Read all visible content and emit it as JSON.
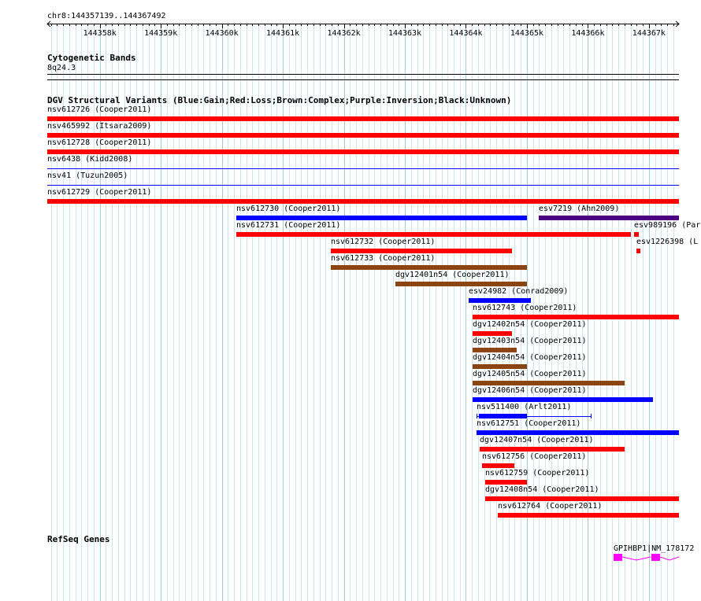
{
  "ruler": {
    "range_label": "chr8:144357139..144367492",
    "start": 144357139,
    "end": 144367492,
    "ticks": [
      {
        "pos": 144358000,
        "label": "144358k"
      },
      {
        "pos": 144359000,
        "label": "144359k"
      },
      {
        "pos": 144360000,
        "label": "144360k"
      },
      {
        "pos": 144361000,
        "label": "144361k"
      },
      {
        "pos": 144362000,
        "label": "144362k"
      },
      {
        "pos": 144363000,
        "label": "144363k"
      },
      {
        "pos": 144364000,
        "label": "144364k"
      },
      {
        "pos": 144365000,
        "label": "144365k"
      },
      {
        "pos": 144366000,
        "label": "144366k"
      },
      {
        "pos": 144367000,
        "label": "144367k"
      }
    ]
  },
  "cytobands": {
    "title": "Cytogenetic Bands",
    "band": "8q24.3"
  },
  "dgv": {
    "title": "DGV Structural Variants (Blue:Gain;Red:Loss;Brown:Complex;Purple:Inversion;Black:Unknown)",
    "colors": {
      "gain": "#0000ff",
      "loss": "#ff0000",
      "complex": "#8b4513",
      "inversion": "#4b0082",
      "unknown": "#000000"
    },
    "features": [
      {
        "label": "nsv612726 (Cooper2011)",
        "type": "loss",
        "start": 144357139,
        "end": 144367492,
        "row": 0,
        "style": "bar"
      },
      {
        "label": "nsv465992 (Itsara2009)",
        "type": "loss",
        "start": 144357139,
        "end": 144367492,
        "row": 1,
        "style": "bar"
      },
      {
        "label": "nsv612728 (Cooper2011)",
        "type": "loss",
        "start": 144357139,
        "end": 144367492,
        "row": 2,
        "style": "bar"
      },
      {
        "label": "nsv6438 (Kidd2008)",
        "type": "gain",
        "start": 144357139,
        "end": 144367492,
        "row": 3,
        "style": "thin"
      },
      {
        "label": "nsv41 (Tuzun2005)",
        "type": "gain",
        "start": 144357139,
        "end": 144367492,
        "row": 4,
        "style": "thin"
      },
      {
        "label": "nsv612729 (Cooper2011)",
        "type": "loss",
        "start": 144357139,
        "end": 144367492,
        "row": 5,
        "style": "bar"
      },
      {
        "label": "nsv612730 (Cooper2011)",
        "type": "gain",
        "start": 144360240,
        "end": 144365000,
        "row": 6,
        "style": "bar"
      },
      {
        "label": "esv7219 (Ahn2009)",
        "type": "inversion",
        "start": 144365200,
        "end": 144367492,
        "row": 6,
        "style": "bar"
      },
      {
        "label": "nsv612731 (Cooper2011)",
        "type": "loss",
        "start": 144360240,
        "end": 144366700,
        "row": 7,
        "style": "bar"
      },
      {
        "label": "esv989196 (Par",
        "type": "loss",
        "start": 144366760,
        "end": 144366840,
        "row": 7,
        "style": "bar"
      },
      {
        "label": "esv1226398 (L",
        "type": "loss",
        "start": 144366790,
        "end": 144366860,
        "row": 8,
        "style": "bar"
      },
      {
        "label": "nsv612732 (Cooper2011)",
        "type": "loss",
        "start": 144361780,
        "end": 144364760,
        "row": 8,
        "style": "bar"
      },
      {
        "label": "nsv612733 (Cooper2011)",
        "type": "complex",
        "start": 144361780,
        "end": 144365000,
        "row": 9,
        "style": "bar"
      },
      {
        "label": "dgv12401n54 (Cooper2011)",
        "type": "complex",
        "start": 144362840,
        "end": 144365000,
        "row": 10,
        "style": "bar"
      },
      {
        "label": "esv24982 (Conrad2009)",
        "type": "gain",
        "start": 144364050,
        "end": 144365060,
        "row": 11,
        "style": "bar"
      },
      {
        "label": "nsv612743 (Cooper2011)",
        "type": "loss",
        "start": 144364110,
        "end": 144367492,
        "row": 12,
        "style": "bar"
      },
      {
        "label": "dgv12402n54 (Cooper2011)",
        "type": "loss",
        "start": 144364110,
        "end": 144364750,
        "row": 13,
        "style": "bar"
      },
      {
        "label": "dgv12403n54 (Cooper2011)",
        "type": "complex",
        "start": 144364110,
        "end": 144364830,
        "row": 14,
        "style": "bar"
      },
      {
        "label": "dgv12404n54 (Cooper2011)",
        "type": "complex",
        "start": 144364110,
        "end": 144365000,
        "row": 15,
        "style": "bar"
      },
      {
        "label": "dgv12405n54 (Cooper2011)",
        "type": "complex",
        "start": 144364110,
        "end": 144366600,
        "row": 16,
        "style": "bar"
      },
      {
        "label": "dgv12406n54 (Cooper2011)",
        "type": "gain",
        "start": 144364110,
        "end": 144367070,
        "row": 17,
        "style": "bar"
      },
      {
        "label": "nsv511400 (Arlt2011)",
        "type": "gain",
        "start": 144364170,
        "end": 144366060,
        "row": 18,
        "style": "split"
      },
      {
        "label": "nsv612751 (Cooper2011)",
        "type": "gain",
        "start": 144364170,
        "end": 144367492,
        "row": 19,
        "style": "bar"
      },
      {
        "label": "dgv12407n54 (Cooper2011)",
        "type": "loss",
        "start": 144364220,
        "end": 144366600,
        "row": 20,
        "style": "bar"
      },
      {
        "label": "nsv612756 (Cooper2011)",
        "type": "loss",
        "start": 144364270,
        "end": 144364800,
        "row": 21,
        "style": "bar"
      },
      {
        "label": "nsv612759 (Cooper2011)",
        "type": "loss",
        "start": 144364320,
        "end": 144365000,
        "row": 22,
        "style": "bar"
      },
      {
        "label": "dgv12408n54 (Cooper2011)",
        "type": "loss",
        "start": 144364320,
        "end": 144367492,
        "row": 23,
        "style": "bar"
      },
      {
        "label": "nsv612764 (Cooper2011)",
        "type": "loss",
        "start": 144364520,
        "end": 144367492,
        "row": 24,
        "style": "bar"
      }
    ]
  },
  "refseq": {
    "title": "RefSeq Genes",
    "gene_label": "GPIHBP1|NM_178172",
    "color": "#ff00ff",
    "connector_color": "#ff00ff"
  }
}
